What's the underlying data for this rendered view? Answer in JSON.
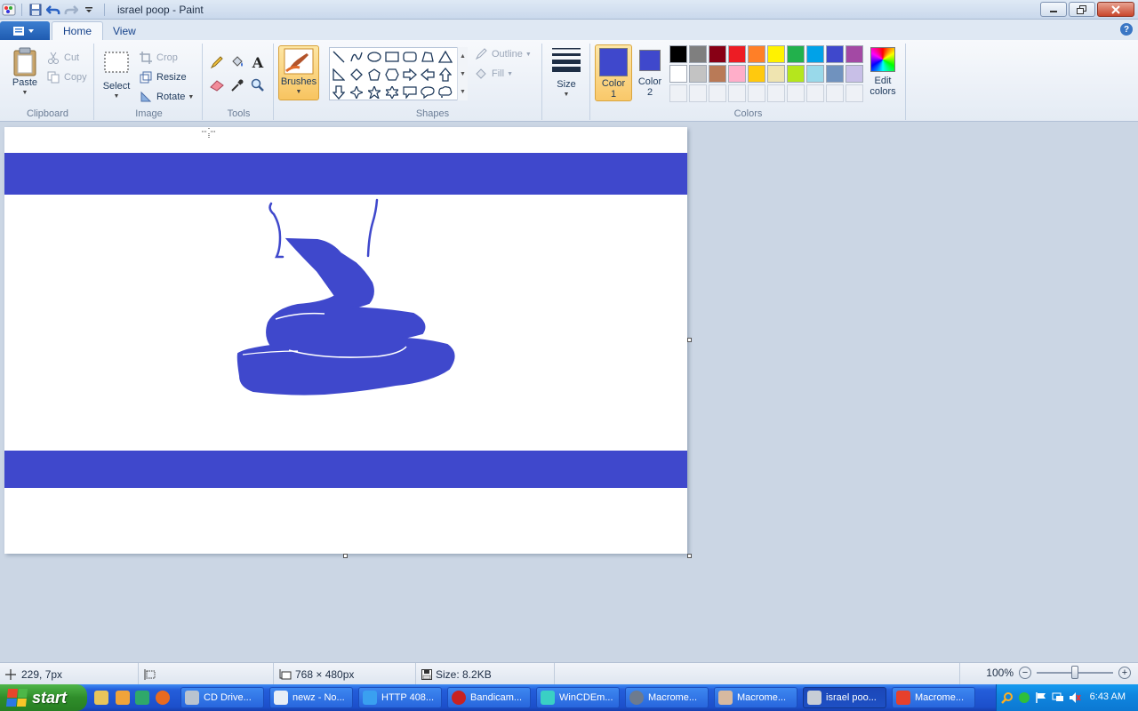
{
  "window": {
    "title": "israel poop - Paint"
  },
  "tabs": [
    {
      "label": "Home"
    },
    {
      "label": "View"
    }
  ],
  "ribbon": {
    "clipboard": {
      "label": "Clipboard",
      "paste": "Paste",
      "cut": "Cut",
      "copy": "Copy"
    },
    "image": {
      "label": "Image",
      "select": "Select",
      "crop": "Crop",
      "resize": "Resize",
      "rotate": "Rotate"
    },
    "tools": {
      "label": "Tools"
    },
    "brushes": "Brushes",
    "shapes": {
      "label": "Shapes",
      "outline": "Outline",
      "fill": "Fill"
    },
    "size": "Size",
    "colors": {
      "label": "Colors",
      "color1": "Color",
      "color1_num": "1",
      "color2": "Color",
      "color2_num": "2",
      "edit": "Edit",
      "edit2": "colors",
      "color1_value": "#3f48cc",
      "color2_value": "#3f48cc",
      "palette_row1": [
        "#000000",
        "#7f7f7f",
        "#880015",
        "#ed1c24",
        "#ff7f27",
        "#fff200",
        "#22b14c",
        "#00a2e8",
        "#3f48cc",
        "#a349a4"
      ],
      "palette_row2": [
        "#ffffff",
        "#c3c3c3",
        "#b97a57",
        "#ffaec9",
        "#ffc90e",
        "#efe4b0",
        "#b5e61d",
        "#99d9ea",
        "#7092be",
        "#c8bfe7"
      ]
    }
  },
  "status": {
    "cursor_pos": "229, 7px",
    "canvas_size": "768 × 480px",
    "file_size": "Size: 8.2KB",
    "zoom": "100%"
  },
  "taskbar": {
    "start": "start",
    "tasks": [
      {
        "label": "CD Drive..."
      },
      {
        "label": "newz - No..."
      },
      {
        "label": "HTTP 408..."
      },
      {
        "label": "Bandicam..."
      },
      {
        "label": "WinCDEm..."
      },
      {
        "label": "Macrome..."
      },
      {
        "label": "Macrome..."
      },
      {
        "label": "israel poo..."
      },
      {
        "label": "Macrome..."
      }
    ],
    "clock": "6:43 AM"
  }
}
